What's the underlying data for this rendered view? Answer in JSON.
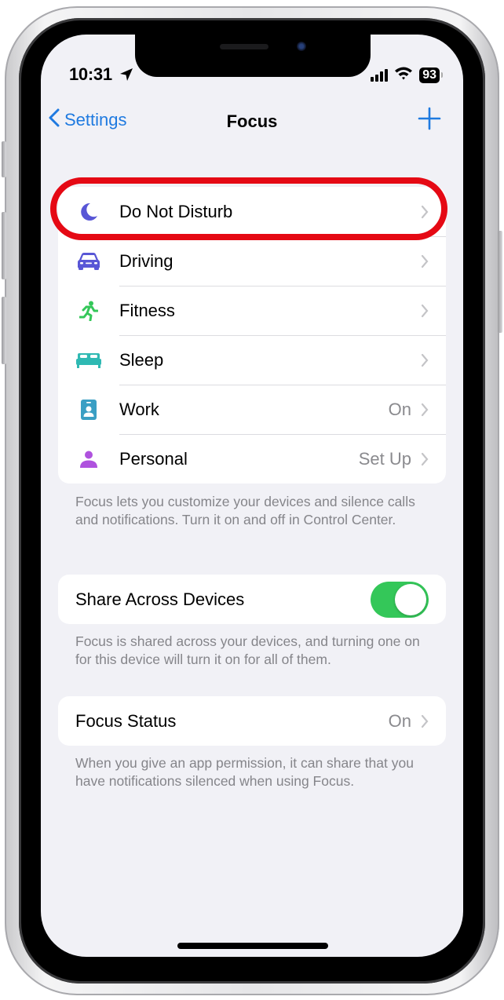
{
  "status_bar": {
    "time": "10:31",
    "battery": "93",
    "icons": [
      "location-arrow-icon",
      "cellular-signal-icon",
      "wifi-icon",
      "battery-icon"
    ]
  },
  "nav": {
    "back_label": "Settings",
    "title": "Focus",
    "add_icon": "plus-icon"
  },
  "focus_modes": [
    {
      "label": "Do Not Disturb",
      "value": "",
      "icon": "moon-icon",
      "color": "#5856d6",
      "highlighted": true
    },
    {
      "label": "Driving",
      "value": "",
      "icon": "car-icon",
      "color": "#5856d6"
    },
    {
      "label": "Fitness",
      "value": "",
      "icon": "running-figure-icon",
      "color": "#34c759"
    },
    {
      "label": "Sleep",
      "value": "",
      "icon": "bed-icon",
      "color": "#2fb9b3"
    },
    {
      "label": "Work",
      "value": "On",
      "icon": "id-badge-icon",
      "color": "#3a9fc4"
    },
    {
      "label": "Personal",
      "value": "Set Up",
      "icon": "person-icon",
      "color": "#af52de"
    }
  ],
  "focus_footnote": "Focus lets you customize your devices and silence calls and notifications. Turn it on and off in Control Center.",
  "share_across_devices": {
    "label": "Share Across Devices",
    "enabled": true,
    "footnote": "Focus is shared across your devices, and turning one on for this device will turn it on for all of them."
  },
  "focus_status": {
    "label": "Focus Status",
    "value": "On",
    "footnote": "When you give an app permission, it can share that you have notifications silenced when using Focus."
  },
  "colors": {
    "accent": "#1f7ae0",
    "toggle_on": "#34c759",
    "highlight_ring": "#e50914",
    "background": "#f1f1f6"
  }
}
